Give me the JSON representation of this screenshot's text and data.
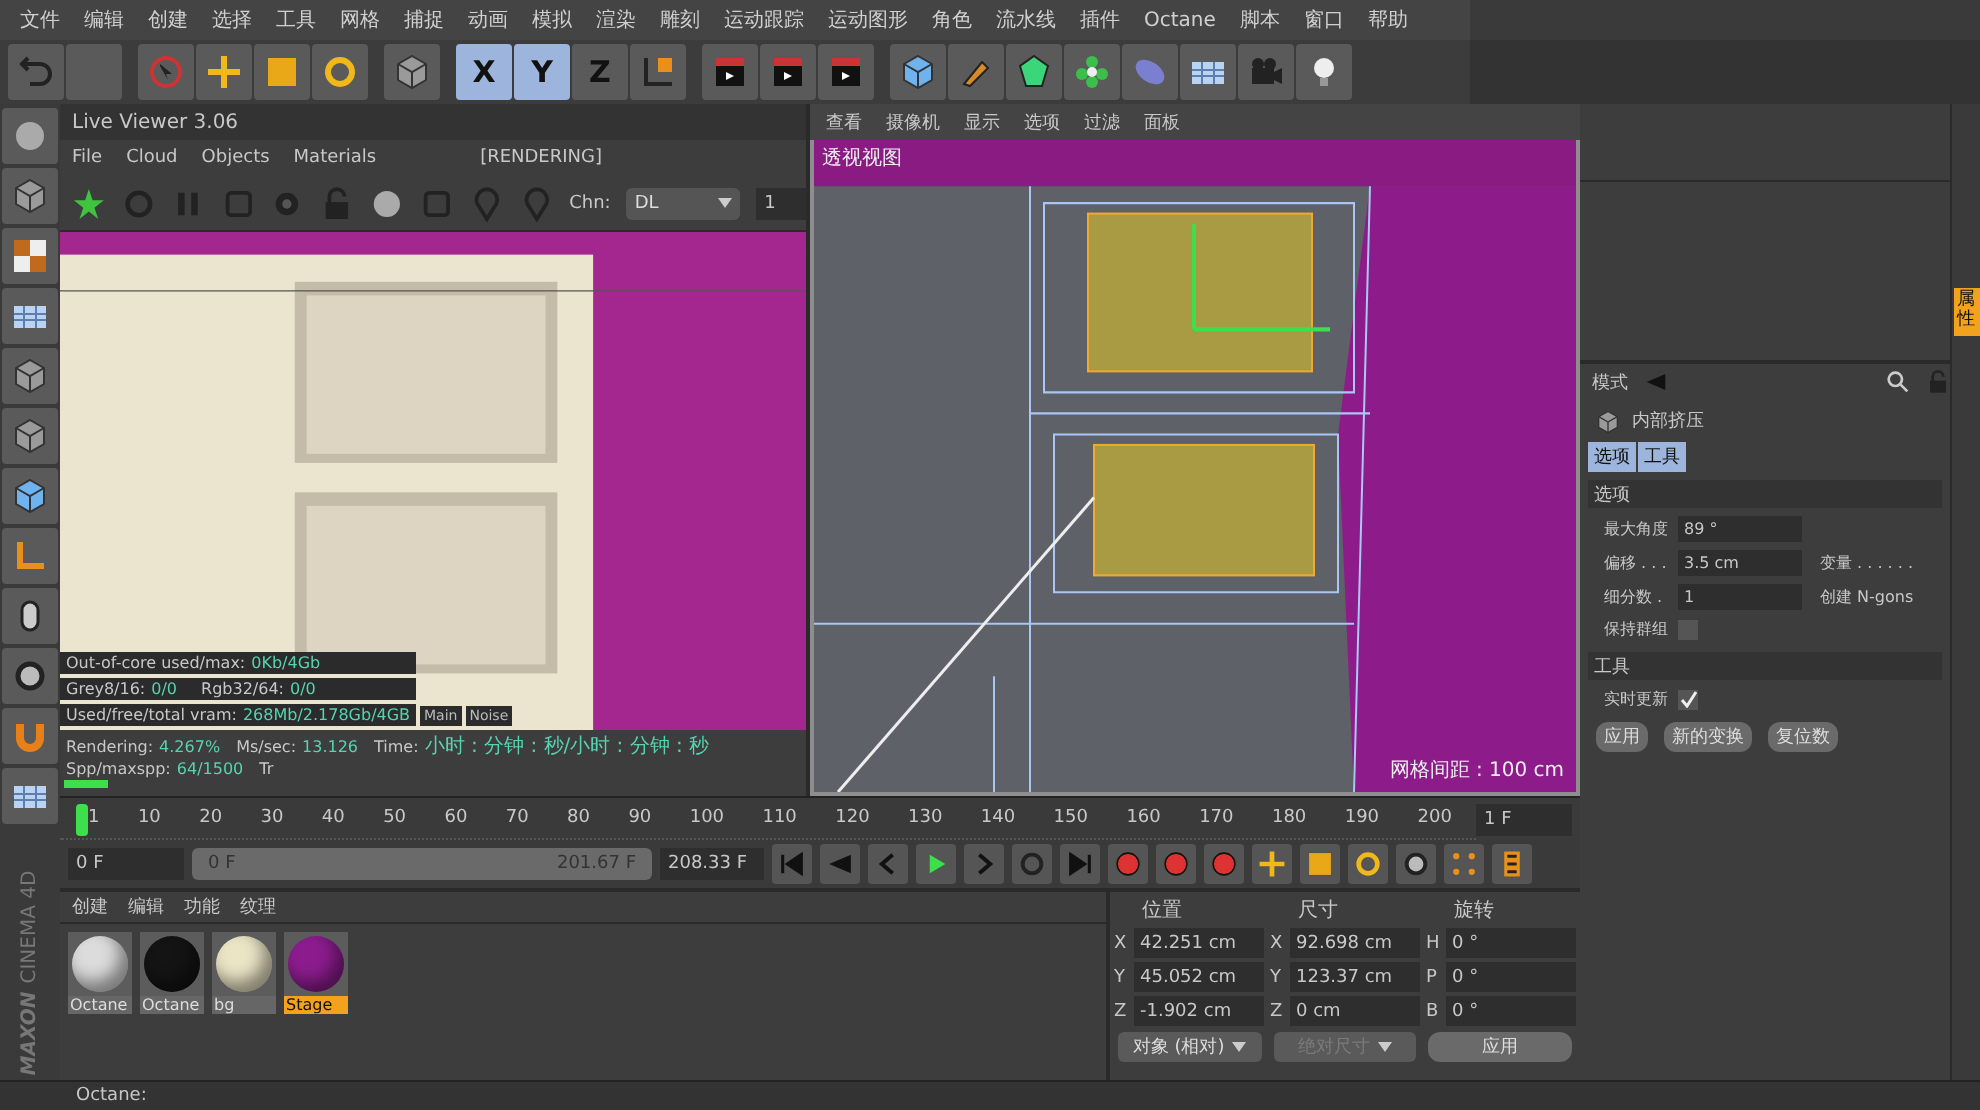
{
  "menu_bar": [
    "文件",
    "编辑",
    "创建",
    "选择",
    "工具",
    "网格",
    "捕捉",
    "动画",
    "模拟",
    "渲染",
    "雕刻",
    "运动跟踪",
    "运动图形",
    "角色",
    "流水线",
    "插件",
    "Octane",
    "脚本",
    "窗口",
    "帮助"
  ],
  "axis_buttons": [
    {
      "label": "X",
      "selected": true
    },
    {
      "label": "Y",
      "selected": true
    },
    {
      "label": "Z",
      "selected": false
    }
  ],
  "live_viewer": {
    "title": "Live Viewer 3.06",
    "menu": [
      "File",
      "Cloud",
      "Objects",
      "Materials"
    ],
    "status": "[RENDERING]",
    "channel_label": "Chn:",
    "channel": "DL",
    "channel_index": "1",
    "stats": [
      [
        {
          "label": "Out-of-core used/max:",
          "value": "0Kb/4Gb"
        }
      ],
      [
        {
          "label": "Grey8/16:",
          "value": "0/0"
        },
        {
          "label": "Rgb32/64:",
          "value": "0/0"
        }
      ],
      [
        {
          "label": "Used/free/total vram:",
          "value": "268Mb/2.178Gb/4GB"
        }
      ]
    ],
    "view_tabs": [
      "Main",
      "Noise"
    ],
    "render_status": [
      {
        "label": "Rendering:",
        "value": "4.267%"
      },
      {
        "label": "Ms/sec:",
        "value": "13.126"
      },
      {
        "label": "Time:",
        "value": "小时 : 分钟 : 秒/小时 : 分钟 : 秒"
      },
      {
        "label": "Spp/maxspp:",
        "value": "64/1500"
      }
    ],
    "render_status_tail": "Tr",
    "progress": {
      "level": 0.06
    }
  },
  "viewport": {
    "menu": [
      "查看",
      "摄像机",
      "显示",
      "选项",
      "过滤",
      "面板"
    ],
    "title": "透视视图",
    "grid_spacing": "网格间距 : 100 cm"
  },
  "timeline": {
    "ticks": [
      "1",
      "10",
      "20",
      "30",
      "40",
      "50",
      "60",
      "70",
      "80",
      "90",
      "100",
      "110",
      "120",
      "130",
      "140",
      "150",
      "160",
      "170",
      "180",
      "190",
      "200"
    ],
    "current_frame": "1 F"
  },
  "transport": {
    "start": "0 F",
    "range_start": "0 F",
    "range_end": "201.67 F",
    "range": {
      "level": 1
    },
    "end": "208.33 F"
  },
  "materials": {
    "menu": [
      "创建",
      "编辑",
      "功能",
      "纹理"
    ],
    "items": [
      {
        "name": "Octane",
        "color": "#dcdcdc",
        "selected": false
      },
      {
        "name": "Octane",
        "color": "#141414",
        "selected": false
      },
      {
        "name": "bg",
        "color": "#ebe5c6",
        "selected": false
      },
      {
        "name": "Stage",
        "color": "#8c1c8e",
        "selected": true
      }
    ]
  },
  "coordinates": {
    "headers": [
      "位置",
      "尺寸",
      "旋转"
    ],
    "rows": [
      [
        {
          "axis": "X",
          "value": "42.251 cm"
        },
        {
          "axis": "X",
          "value": "92.698 cm"
        },
        {
          "axis": "H",
          "value": "0 °"
        }
      ],
      [
        {
          "axis": "Y",
          "value": "45.052 cm"
        },
        {
          "axis": "Y",
          "value": "123.37 cm"
        },
        {
          "axis": "P",
          "value": "0 °"
        }
      ],
      [
        {
          "axis": "Z",
          "value": "-1.902 cm"
        },
        {
          "axis": "Z",
          "value": "0 cm"
        },
        {
          "axis": "B",
          "value": "0 °"
        }
      ]
    ],
    "mode": "对象 (相对)",
    "size_mode": {
      "label": "绝对尺寸",
      "disabled": true
    },
    "apply": "应用"
  },
  "attributes": {
    "mode": "模式",
    "title": "内部挤压",
    "tabs": [
      {
        "label": "选项",
        "selected": true
      },
      {
        "label": "工具",
        "selected": true
      }
    ],
    "sections": [
      {
        "title": "选项",
        "rows": [
          {
            "left": {
              "kind": "input",
              "label": "最大角度",
              "value": "89 °"
            }
          },
          {
            "left": {
              "kind": "input",
              "label": "偏移 . . .",
              "value": "3.5 cm"
            },
            "right": {
              "kind": "text",
              "label": "变量 . . . . . ."
            }
          },
          {
            "left": {
              "kind": "input",
              "label": "细分数 .",
              "value": "1"
            },
            "right": {
              "kind": "text",
              "label": "创建 N-gons"
            }
          },
          {
            "left": {
              "kind": "checkbox",
              "label": "保持群组",
              "checked": false
            }
          }
        ]
      },
      {
        "title": "工具",
        "rows": [
          {
            "left": {
              "kind": "checkbox",
              "label": "实时更新",
              "checked": true
            }
          }
        ]
      }
    ],
    "buttons": [
      "应用",
      "新的变换",
      "复位数"
    ]
  },
  "side_tabs": [
    {
      "label": "属性",
      "selected": true
    }
  ],
  "logo": {
    "brand": "MAXON",
    "product": "CINEMA 4D"
  },
  "status_bar": "Octane:"
}
